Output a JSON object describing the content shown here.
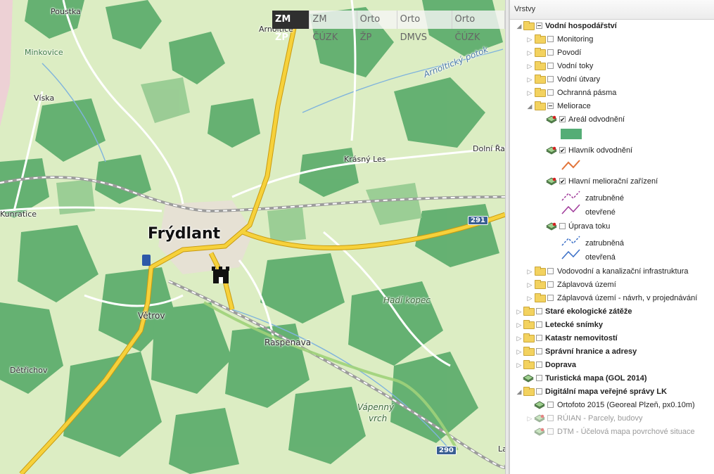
{
  "map": {
    "labels": {
      "poustka": "Poustka",
      "minkovice": "Minkovice",
      "viska": "Víska",
      "arnoltice": "Arnoltice",
      "frydlant": "Frýdlant",
      "vetrov": "Větrov",
      "raspenava": "Raspenava",
      "detrichov": "Dětřichov",
      "kunratice": "Kunratice",
      "krasny_les": "Krásný Les",
      "dolni_ra": "Dolní Řa",
      "arnoltický_potok": "Arnoltický potok",
      "hadi_kopec": "Hadí kopec",
      "vapenny_vrch_1": "Vápenný",
      "vapenny_vrch_2": "vrch",
      "la": "La"
    },
    "shields": {
      "s291": "291",
      "s290": "290"
    }
  },
  "base_layers": [
    {
      "label": "ZM ŽP",
      "active": true
    },
    {
      "label": "ZM ČÚZK",
      "active": false
    },
    {
      "label": "Orto ŽP",
      "active": false
    },
    {
      "label": "Orto DMVS",
      "active": false
    },
    {
      "label": "Orto ČÚZK",
      "active": false
    }
  ],
  "panel": {
    "title": "Vrstvy",
    "nodes": {
      "vodni_hospodarstvi": "Vodní hospodářství",
      "monitoring": "Monitoring",
      "povodi": "Povodí",
      "vodni_toky": "Vodní toky",
      "vodni_utvary": "Vodní útvary",
      "ochranna_pasma": "Ochranná pásma",
      "meliorace": "Meliorace",
      "arealy": "Areál odvodnění",
      "hlavnik": "Hlavník odvodnění",
      "hlavni_mel": "Hlavní meliorační zařízení",
      "zatrubnene": "zatrubněné",
      "otevrene": "otevřené",
      "uprava_toku": "Úprava toku",
      "zatrubnena": "zatrubněná",
      "otevrena": "otevřená",
      "vodovodni": "Vodovodní a kanalizační infrastruktura",
      "zaplavova": "Záplavová území",
      "zaplavova_navrh": "Záplavová území - návrh, v projednávání",
      "stare_ekol": "Staré ekologické zátěže",
      "letecke": "Letecké snímky",
      "katastr": "Katastr nemovitostí",
      "spravni": "Správní hranice a adresy",
      "doprava": "Doprava",
      "turisticka": "Turistická mapa (GOL 2014)",
      "digitalni": "Digitální mapa veřejné správy LK",
      "ortofoto": "Ortofoto 2015 (Georeal Plzeň, px0.10m)",
      "ruian": "RÚIAN - Parcely, budovy",
      "dtm": "DTM - Účelová mapa povrchové situace"
    },
    "colors": {
      "areal": "#55ad76",
      "hlavnik": "#e2753b",
      "hlavni_mel": "#a03a9a",
      "uprava": "#3a6fc7"
    }
  }
}
